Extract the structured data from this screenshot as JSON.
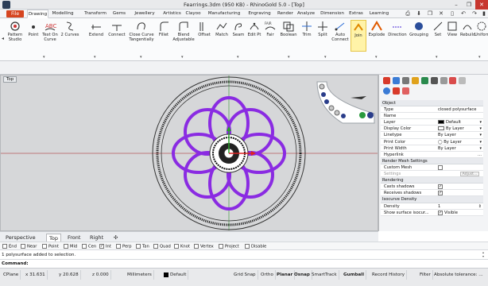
{
  "titlebar": {
    "title": "Fearrings.3dm (950 KB) - RhinoGold 5.0 - [Top]",
    "minimize": "–",
    "restore": "❐",
    "close": "✕"
  },
  "ribbon": {
    "file_tab": "File",
    "tabs": [
      "Drawing",
      "Modelling",
      "Transform",
      "Gems",
      "Jewellery",
      "Artistics",
      "Clayoo",
      "Manufacturing",
      "Engraving",
      "Render",
      "Analyze",
      "Dimension",
      "Extras",
      "Learning"
    ],
    "active_tab": "Drawing",
    "tools": [
      {
        "label": "Pattern Studio",
        "icon": "pattern-studio-icon"
      },
      {
        "label": "Point",
        "icon": "point-icon"
      },
      {
        "label": "Text On Curve",
        "icon": "text-on-curve-icon"
      },
      {
        "label": "2 Curves",
        "icon": "two-curves-icon"
      },
      {
        "label": "Extend",
        "icon": "extend-icon"
      },
      {
        "label": "Connect",
        "icon": "connect-icon"
      },
      {
        "label": "Close Curve Tangentially",
        "icon": "close-curve-icon"
      },
      {
        "label": "Fillet",
        "icon": "fillet-icon"
      },
      {
        "label": "Blend Adjustable",
        "icon": "blend-icon"
      },
      {
        "label": "Offset",
        "icon": "offset-icon"
      },
      {
        "label": "Match",
        "icon": "match-icon"
      },
      {
        "label": "Seam",
        "icon": "seam-icon"
      },
      {
        "label": "Edit Pt",
        "icon": "edit-pt-icon"
      },
      {
        "label": "Fair",
        "icon": "fair-icon"
      },
      {
        "label": "Boolean",
        "icon": "boolean-icon"
      },
      {
        "label": "Trim",
        "icon": "trim-icon"
      },
      {
        "label": "Split",
        "icon": "split-icon"
      },
      {
        "label": "Auto Connect",
        "icon": "auto-connect-icon"
      },
      {
        "label": "Join",
        "icon": "join-icon"
      },
      {
        "label": "Explode",
        "icon": "explode-icon"
      },
      {
        "label": "Direction",
        "icon": "direction-icon"
      },
      {
        "label": "Grouping",
        "icon": "grouping-icon"
      },
      {
        "label": "Set",
        "icon": "set-icon"
      },
      {
        "label": "View",
        "icon": "view-icon"
      },
      {
        "label": "Rebuild",
        "icon": "rebuild-icon"
      },
      {
        "label": "Uniform",
        "icon": "uniform-icon"
      }
    ],
    "highlighted_tool": "Join",
    "fair_icon_text": "FAIR"
  },
  "viewport": {
    "label": "Top",
    "curve_color": "#8a2be2"
  },
  "properties": {
    "object_header": "Object",
    "rows": [
      {
        "k": "Type",
        "v": "closed polysurface"
      },
      {
        "k": "Name",
        "v": ""
      },
      {
        "k": "Layer",
        "v": "Default"
      },
      {
        "k": "Display Color",
        "v": "By Layer"
      },
      {
        "k": "Linetype",
        "v": "By Layer"
      },
      {
        "k": "Print Color",
        "v": "By Layer"
      },
      {
        "k": "Print Width",
        "v": "By Layer"
      },
      {
        "k": "Hyperlink",
        "v": ""
      }
    ],
    "render_mesh_header": "Render Mesh Settings",
    "custom_mesh": "Custom Mesh",
    "settings": "Settings",
    "adjust": "Adjust...",
    "rendering_header": "Rendering",
    "casts_shadows": "Casts shadows",
    "receives_shadows": "Receives shadows",
    "isocurve_header": "Isocurve Density",
    "density_label": "Density",
    "density_value": "1",
    "show_iso_label": "Show surface isocur...",
    "visible": "Visible"
  },
  "viewtabs": {
    "tabs": [
      "Perspective",
      "Top",
      "Front",
      "Right"
    ],
    "active": "Top",
    "add": "✣"
  },
  "osnaps": [
    {
      "label": "End",
      "checked": false
    },
    {
      "label": "Near",
      "checked": false
    },
    {
      "label": "Point",
      "checked": false
    },
    {
      "label": "Mid",
      "checked": false
    },
    {
      "label": "Cen",
      "checked": false
    },
    {
      "label": "Int",
      "checked": true
    },
    {
      "label": "Perp",
      "checked": false
    },
    {
      "label": "Tan",
      "checked": false
    },
    {
      "label": "Quad",
      "checked": false
    },
    {
      "label": "Knot",
      "checked": false
    },
    {
      "label": "Vertex",
      "checked": false
    },
    {
      "label": "Project",
      "checked": false
    },
    {
      "label": "Disable",
      "checked": false
    }
  ],
  "command": {
    "history": "1 polysurface added to selection.",
    "prompt": "Command:"
  },
  "status": {
    "cplane": "CPlane",
    "x": "x 31.631",
    "y": "y 20.628",
    "z": "z 0.000",
    "units": "Millimeters",
    "layer": "Default",
    "grid_snap": "Grid Snap",
    "ortho": "Ortho",
    "planar": "Planar",
    "osnap": "Osnap",
    "smarttrack": "SmartTrack",
    "gumball": "Gumball",
    "record_history": "Record History",
    "filter": "Filter",
    "tolerance": "Absolute tolerance: ..."
  }
}
